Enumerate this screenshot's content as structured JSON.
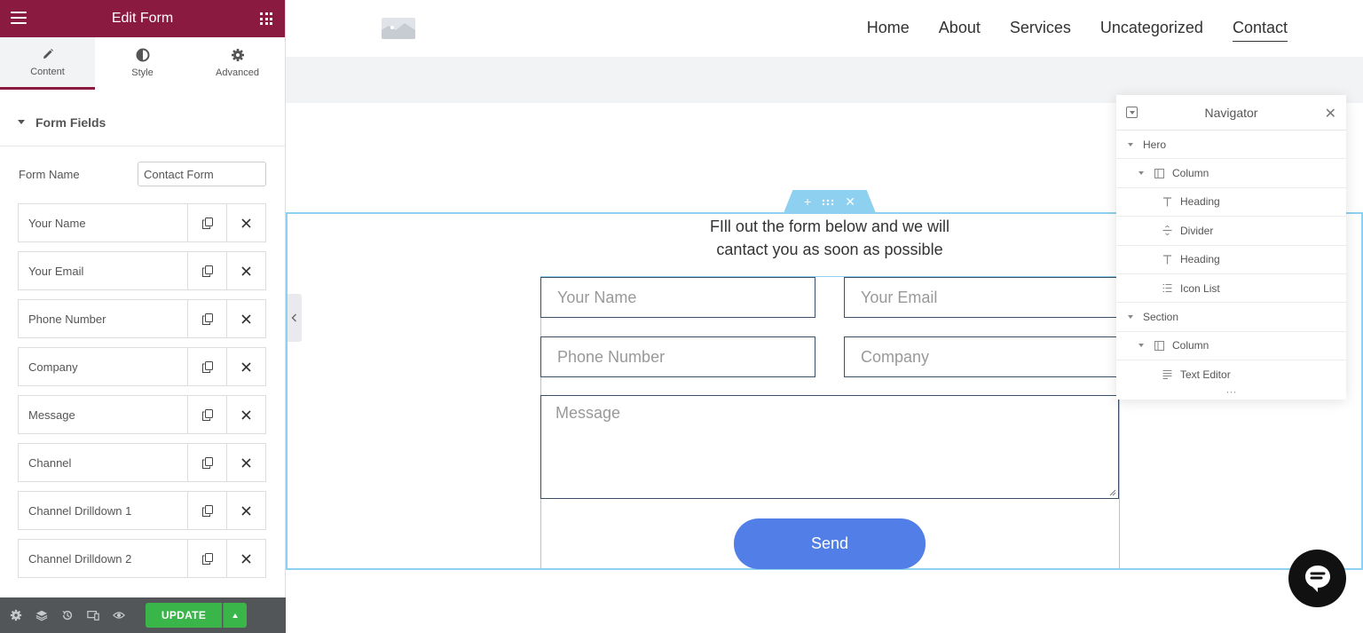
{
  "panel": {
    "title": "Edit Form",
    "tabs": [
      {
        "label": "Content",
        "icon": "pencil-icon"
      },
      {
        "label": "Style",
        "icon": "half-circle-icon"
      },
      {
        "label": "Advanced",
        "icon": "gear-icon"
      }
    ],
    "section_title": "Form Fields",
    "form_name_label": "Form Name",
    "form_name_value": "Contact Form",
    "fields": [
      "Your Name",
      "Your Email",
      "Phone Number",
      "Company",
      "Message",
      "Channel",
      "Channel Drilldown 1",
      "Channel Drilldown 2"
    ],
    "update_label": "UPDATE"
  },
  "site": {
    "nav": [
      "Home",
      "About",
      "Services",
      "Uncategorized",
      "Contact"
    ],
    "intro_line1": "FIll out the form below and we will",
    "intro_line2": "cantact you as soon as possible",
    "form": {
      "name_placeholder": "Your Name",
      "email_placeholder": "Your Email",
      "phone_placeholder": "Phone Number",
      "company_placeholder": "Company",
      "message_placeholder": "Message",
      "send_label": "Send"
    }
  },
  "navigator": {
    "title": "Navigator",
    "items": [
      {
        "label": "Hero",
        "type": "section"
      },
      {
        "label": "Column",
        "type": "column"
      },
      {
        "label": "Heading",
        "type": "heading"
      },
      {
        "label": "Divider",
        "type": "divider"
      },
      {
        "label": "Heading",
        "type": "heading"
      },
      {
        "label": "Icon List",
        "type": "icon-list"
      },
      {
        "label": "Section",
        "type": "section"
      },
      {
        "label": "Column",
        "type": "column"
      },
      {
        "label": "Text Editor",
        "type": "text-editor"
      }
    ]
  },
  "colors": {
    "brand": "#8b1a41",
    "update_green": "#39b54a",
    "send_blue": "#527ee8",
    "selection_blue": "#8ed0ef"
  }
}
